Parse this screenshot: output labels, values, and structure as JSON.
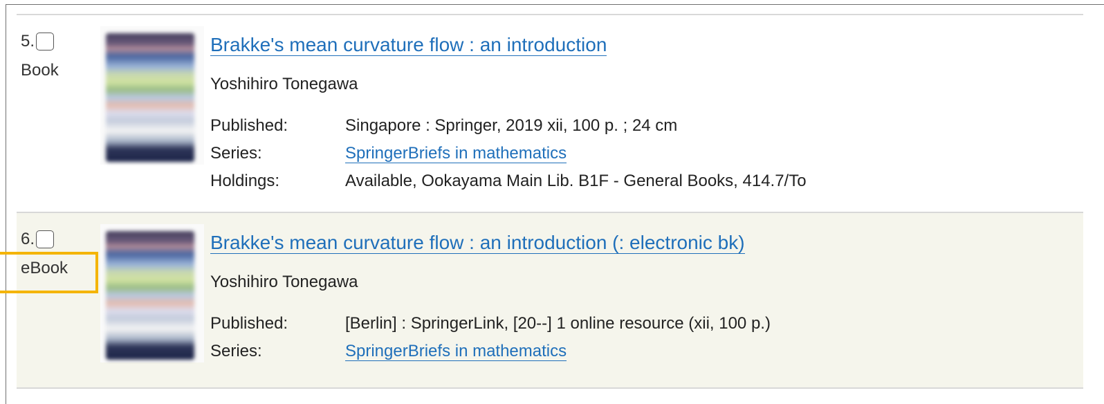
{
  "results": [
    {
      "number": "5.",
      "type": "Book",
      "title": "Brakke's mean curvature flow : an introduction",
      "author": "Yoshihiro Tonegawa",
      "published_label": "Published:",
      "published_value": "Singapore : Springer, 2019  xii, 100 p. ; 24 cm",
      "series_label": "Series:",
      "series_value": "SpringerBriefs in mathematics",
      "holdings_label": "Holdings:",
      "holdings_value": "Available, Ookayama    Main Lib. B1F - General Books, 414.7/To"
    },
    {
      "number": "6.",
      "type": "eBook",
      "title": "Brakke's mean curvature flow : an introduction (: electronic bk)",
      "author": "Yoshihiro Tonegawa",
      "published_label": "Published:",
      "published_value": "[Berlin] : SpringerLink, [20--]  1 online resource (xii, 100 p.)",
      "series_label": "Series:",
      "series_value": "SpringerBriefs in mathematics"
    }
  ],
  "colors": {
    "link": "#1f6fba",
    "highlight": "#f4b400",
    "alt_row_bg": "#f5f5ec"
  }
}
